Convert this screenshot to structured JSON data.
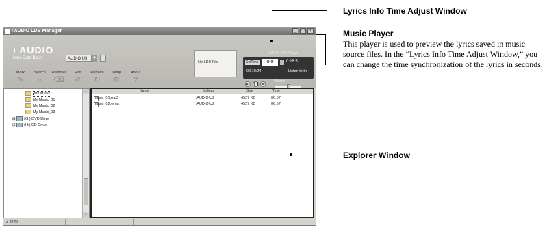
{
  "window": {
    "title": "i AUDIO LDB Manager",
    "logo_text": "i AUDIO",
    "lyric_db_label": "Lyric Data Base",
    "lyric_db_value": "AUDIO U3",
    "window_buttons": [
      "_",
      "□",
      "x"
    ]
  },
  "toolbar": {
    "items": [
      {
        "label": "Mark",
        "icon": "mark-icon"
      },
      {
        "label": "Search",
        "icon": "search-icon"
      },
      {
        "label": "Remove",
        "icon": "remove-icon"
      },
      {
        "label": "Edit",
        "icon": "edit-icon"
      },
      {
        "label": "Refresh",
        "icon": "refresh-icon"
      },
      {
        "label": "Setup",
        "icon": "setup-icon"
      },
      {
        "label": "About",
        "icon": "about-icon"
      }
    ]
  },
  "lyric_box": {
    "text": "No LDB File"
  },
  "player": {
    "label": "iAUDIO LDB Player",
    "pitch_select": "SetTime",
    "adjust_value": "0.0",
    "time_display": "0:26.5",
    "time_code": "00:10:24",
    "lyric_line": "Listen to th",
    "volume_label": "Volume",
    "volume_level": 0.55,
    "buttons": [
      "▶",
      "❚❚",
      "■"
    ]
  },
  "sidebar": {
    "items": [
      {
        "label": "My Music",
        "icon": "folder-icon",
        "selected": true
      },
      {
        "label": "My Music_01",
        "icon": "folder-icon"
      },
      {
        "label": "My Music_02",
        "icon": "folder-icon"
      },
      {
        "label": "My Music_03",
        "icon": "folder-icon"
      },
      {
        "label": "(G:) DVD Drive",
        "icon": "dvd-drive-icon"
      },
      {
        "label": "(H:) CD Drive",
        "icon": "cd-drive-icon"
      }
    ]
  },
  "explorer": {
    "columns": [
      "Name",
      "Making",
      "Size",
      "Time"
    ],
    "rows": [
      {
        "name": "music_01.mp3",
        "making": "iAUDIO U2",
        "size": "4527 KB",
        "time": "06:57"
      },
      {
        "name": "music_02.wma",
        "making": "iAUDIO U2",
        "size": "4527 KB",
        "time": "06:57"
      }
    ]
  },
  "statusbar": {
    "text": "2 Items"
  },
  "annotations": {
    "lyrics_adjust_title": "Lyrics Info Time Adjust Window",
    "music_player_title": "Music Player",
    "music_player_body": "This player is used to preview the lyrics saved in music source files. In the “Lyrics Info Time Adjust Window,” you can change the time synchronization of the lyrics in seconds.",
    "explorer_title": "Explorer Window"
  }
}
